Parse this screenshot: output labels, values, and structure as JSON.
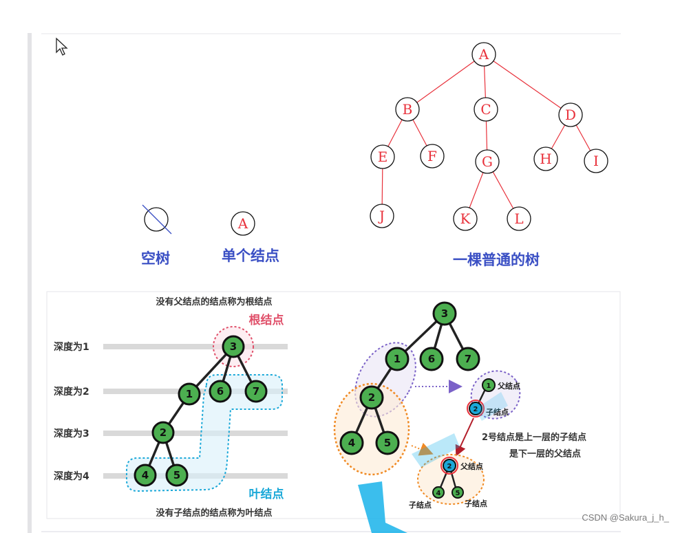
{
  "top_figure": {
    "tree_nodes": [
      "A",
      "B",
      "C",
      "D",
      "E",
      "F",
      "G",
      "H",
      "I",
      "J",
      "K",
      "L"
    ],
    "empty_tree_caption": "空树",
    "single_node_label": "A",
    "single_node_caption": "单个结点",
    "normal_tree_caption": "一棵普通的树"
  },
  "bottom_figure": {
    "root_desc": "没有父结点的结点称为根结点",
    "root_label": "根结点",
    "depth_labels": [
      "深度为1",
      "深度为2",
      "深度为3",
      "深度为4"
    ],
    "leaf_label": "叶结点",
    "leaf_desc": "没有子结点的结点称为叶结点",
    "left_tree_nodes": [
      "3",
      "1",
      "6",
      "7",
      "2",
      "4",
      "5"
    ],
    "right_tree_nodes": [
      "3",
      "1",
      "6",
      "7",
      "2",
      "4",
      "5"
    ],
    "parent_label": "父结点",
    "child_label": "子结点",
    "mini1_nodes": [
      "1",
      "2"
    ],
    "mini2_nodes": [
      "2",
      "4",
      "5"
    ],
    "explain_line1": "2号结点是上一层的子结点",
    "explain_line2": "是下一层的父结点",
    "child_label_bottom_left": "子结点",
    "child_label_bottom_right": "子结点"
  },
  "watermark": "CSDN @Sakura_j_h_",
  "colors": {
    "tree_red": "#e8303a",
    "caption_blue": "#3a4fc4",
    "node_green": "#4caf50",
    "leaf_cyan": "#1aa8d8",
    "root_pink": "#e0506a",
    "orange": "#f08a24",
    "purple": "#7b62c8"
  },
  "icons": {
    "cursor": "mouse-pointer-icon"
  }
}
